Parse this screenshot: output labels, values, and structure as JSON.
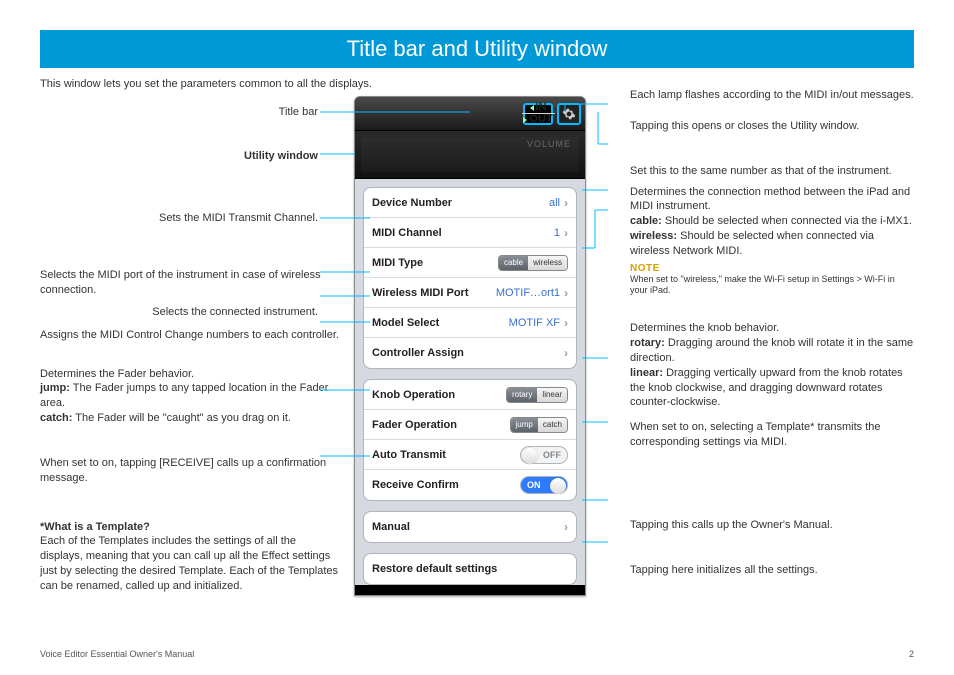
{
  "header": {
    "title": "Title bar and Utility window"
  },
  "intro": "This window lets you set the parameters common to all the displays.",
  "left": {
    "title_bar_label": "Title bar",
    "utility_window_label": "Utility window",
    "midi_channel_desc": "Sets the MIDI Transmit Channel.",
    "wireless_port_desc": "Selects the MIDI port of the instrument in case of wireless connection.",
    "model_select_desc": "Selects the connected instrument.",
    "controller_assign_desc": "Assigns the MIDI Control Change numbers to each controller.",
    "fader_title": "Determines the Fader behavior.",
    "fader_jump_label": "jump:",
    "fader_jump_text": " The Fader jumps to any tapped location in the Fader area.",
    "fader_catch_label": "catch:",
    "fader_catch_text": " The Fader will be \"caught\" as you drag on it.",
    "receive_confirm_desc": "When set to on, tapping [RECEIVE] calls up a confirmation message.",
    "template_title": "*What is a Template?",
    "template_text": "Each of the Templates includes the settings of all the displays, meaning that you can call up all the Effect settings just by selecting the desired Template. Each of the Templates can be renamed, called up and initialized."
  },
  "right": {
    "lamp_desc": "Each lamp flashes according to the MIDI in/out messages.",
    "gear_desc": "Tapping this opens or closes the Utility window.",
    "device_num_desc": "Set this to the same number as that of the instrument.",
    "midi_type_desc": "Determines the connection method between the iPad and MIDI instrument.",
    "cable_label": "cable:",
    "cable_text": " Should be selected when connected via the i-MX1.",
    "wireless_label": "wireless:",
    "wireless_text": " Should be selected when connected via wireless Network MIDI.",
    "note_label": "NOTE",
    "note_text": "When set to \"wireless,\" make the Wi-Fi setup in Settings > Wi-Fi in your iPad.",
    "knob_title": "Determines the knob behavior.",
    "rotary_label": "rotary:",
    "rotary_text": " Dragging around the knob will rotate it in the same direction.",
    "linear_label": "linear:",
    "linear_text": " Dragging vertically upward from the knob rotates the knob clockwise, and dragging downward rotates counter-clockwise.",
    "auto_transmit_desc": "When set to on, selecting a Template* transmits the corresponding settings via MIDI.",
    "manual_desc": "Tapping this calls up the Owner's Manual.",
    "restore_desc": "Tapping here initializes all the settings."
  },
  "screenshot": {
    "midi_in": "IN",
    "midi_out": "OUT",
    "volume_label": "VOLUME",
    "groups": [
      [
        {
          "label": "Device Number",
          "value": "all",
          "chev": true
        },
        {
          "label": "MIDI Channel",
          "value": "1",
          "chev": true
        },
        {
          "label": "MIDI Type",
          "seg": [
            "cable",
            "wireless"
          ],
          "active": 0
        },
        {
          "label": "Wireless MIDI Port",
          "value": "MOTIF…ort1",
          "chev": true
        },
        {
          "label": "Model Select",
          "value": "MOTIF XF",
          "chev": true
        },
        {
          "label": "Controller Assign",
          "chev": true
        }
      ],
      [
        {
          "label": "Knob Operation",
          "seg": [
            "rotary",
            "linear"
          ],
          "active": 0
        },
        {
          "label": "Fader Operation",
          "seg": [
            "jump",
            "catch"
          ],
          "active": 0
        },
        {
          "label": "Auto Transmit",
          "toggle": "off",
          "toggle_text": "OFF"
        },
        {
          "label": "Receive Confirm",
          "toggle": "on",
          "toggle_text": "ON"
        }
      ],
      [
        {
          "label": "Manual",
          "chev": true
        }
      ],
      [
        {
          "label": "Restore default settings"
        }
      ]
    ]
  },
  "footer": {
    "left": "Voice Editor Essential Owner's Manual",
    "page": "2"
  }
}
